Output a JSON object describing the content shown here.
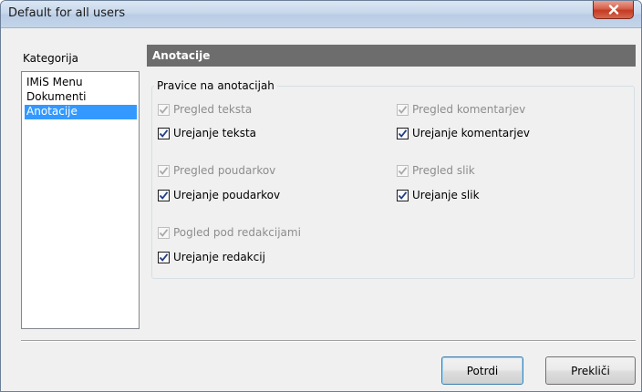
{
  "window": {
    "title": "Default for all users"
  },
  "category": {
    "label": "Kategorija",
    "items": [
      {
        "label": "IMiS Menu",
        "selected": false
      },
      {
        "label": "Dokumenti",
        "selected": false
      },
      {
        "label": "Anotacije",
        "selected": true
      }
    ]
  },
  "section": {
    "title": "Anotacije",
    "group_title": "Pravice na anotacijah",
    "checkboxes": [
      {
        "label": "Pregled teksta",
        "checked": true,
        "enabled": false
      },
      {
        "label": "Urejanje teksta",
        "checked": true,
        "enabled": true
      },
      {
        "label": "Pregled poudarkov",
        "checked": true,
        "enabled": false
      },
      {
        "label": "Urejanje poudarkov",
        "checked": true,
        "enabled": true
      },
      {
        "label": "Pogled pod redakcijami",
        "checked": true,
        "enabled": false
      },
      {
        "label": "Urejanje redakcij",
        "checked": true,
        "enabled": true
      },
      {
        "label": "Pregled komentarjev",
        "checked": true,
        "enabled": false
      },
      {
        "label": "Urejanje komentarjev",
        "checked": true,
        "enabled": true
      },
      {
        "label": "Pregled slik",
        "checked": true,
        "enabled": false
      },
      {
        "label": "Urejanje slik",
        "checked": true,
        "enabled": true
      }
    ]
  },
  "buttons": {
    "confirm": "Potrdi",
    "cancel": "Prekliči"
  }
}
